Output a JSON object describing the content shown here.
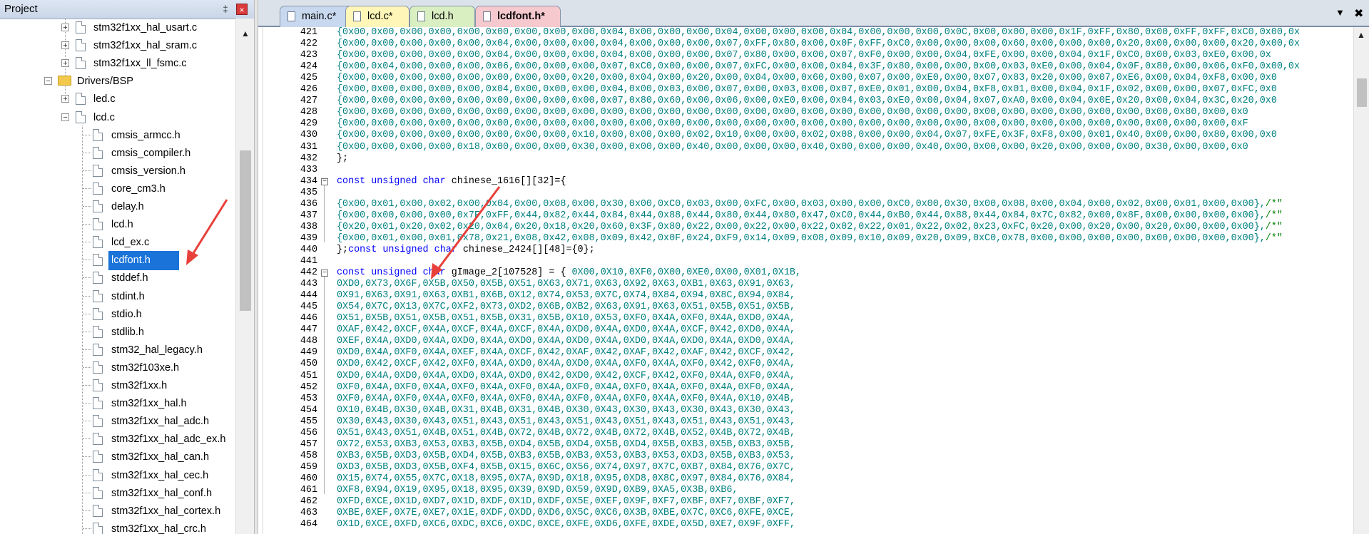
{
  "project_panel": {
    "title": "Project",
    "pin_glyph": "‡",
    "close_glyph": "×",
    "tree": [
      {
        "label": "stm32f1xx_hal_usart.c",
        "kind": "file-expand"
      },
      {
        "label": "stm32f1xx_hal_sram.c",
        "kind": "file-expand"
      },
      {
        "label": "stm32f1xx_ll_fsmc.c",
        "kind": "file-expand"
      },
      {
        "label": "Drivers/BSP",
        "kind": "folder"
      },
      {
        "label": "led.c",
        "kind": "file-expand"
      },
      {
        "label": "lcd.c",
        "kind": "file-collapse"
      },
      {
        "label": "cmsis_armcc.h",
        "kind": "header"
      },
      {
        "label": "cmsis_compiler.h",
        "kind": "header"
      },
      {
        "label": "cmsis_version.h",
        "kind": "header"
      },
      {
        "label": "core_cm3.h",
        "kind": "header"
      },
      {
        "label": "delay.h",
        "kind": "header"
      },
      {
        "label": "lcd.h",
        "kind": "header"
      },
      {
        "label": "lcd_ex.c",
        "kind": "header"
      },
      {
        "label": "lcdfont.h",
        "kind": "header",
        "selected": true
      },
      {
        "label": "stddef.h",
        "kind": "header"
      },
      {
        "label": "stdint.h",
        "kind": "header"
      },
      {
        "label": "stdio.h",
        "kind": "header"
      },
      {
        "label": "stdlib.h",
        "kind": "header"
      },
      {
        "label": "stm32_hal_legacy.h",
        "kind": "header"
      },
      {
        "label": "stm32f103xe.h",
        "kind": "header"
      },
      {
        "label": "stm32f1xx.h",
        "kind": "header"
      },
      {
        "label": "stm32f1xx_hal.h",
        "kind": "header"
      },
      {
        "label": "stm32f1xx_hal_adc.h",
        "kind": "header"
      },
      {
        "label": "stm32f1xx_hal_adc_ex.h",
        "kind": "header"
      },
      {
        "label": "stm32f1xx_hal_can.h",
        "kind": "header"
      },
      {
        "label": "stm32f1xx_hal_cec.h",
        "kind": "header"
      },
      {
        "label": "stm32f1xx_hal_conf.h",
        "kind": "header"
      },
      {
        "label": "stm32f1xx_hal_cortex.h",
        "kind": "header"
      },
      {
        "label": "stm32f1xx_hal_crc.h",
        "kind": "header"
      }
    ]
  },
  "editor": {
    "tabs": [
      {
        "label": "main.c*"
      },
      {
        "label": "lcd.c*"
      },
      {
        "label": "lcd.h"
      },
      {
        "label": "lcdfont.h*",
        "active": true
      }
    ],
    "tab_menu_glyph": "▼",
    "tab_close_glyph": "✖",
    "lines": [
      {
        "n": "421",
        "t": "{0x00,0x00,0x00,0x00,0x00,0x00,0x00,0x00,0x00,0x04,0x00,0x00,0x00,0x04,0x00,0x00,0x00,0x04,0x00,0x00,0x00,0x0C,0x00,0x00,0x00,0x1F,0xFF,0x80,0x00,0xFF,0xFF,0xC0,0x00,0x"
      },
      {
        "n": "422",
        "t": "{0x00,0x00,0x00,0x00,0x00,0x04,0x00,0x00,0x00,0x04,0x00,0x00,0x00,0x07,0xFF,0x80,0x00,0x0F,0xFF,0xC0,0x00,0x00,0x00,0x60,0x00,0x00,0x00,0x20,0x00,0x00,0x00,0x20,0x00,0x"
      },
      {
        "n": "423",
        "t": "{0x00,0x00,0x00,0x00,0x00,0x04,0x00,0x00,0x00,0x04,0x00,0x00,0x00,0x07,0x80,0x00,0x00,0x07,0xF0,0x00,0x00,0x04,0xFE,0x00,0x00,0x04,0x1F,0xC0,0x00,0x03,0xE0,0x00,0x"
      },
      {
        "n": "424",
        "t": "{0x00,0x04,0x00,0x00,0x00,0x06,0x00,0x00,0x00,0x07,0xC0,0x00,0x00,0x07,0xFC,0x00,0x00,0x04,0x3F,0x80,0x00,0x00,0x00,0x03,0xE0,0x00,0x04,0x0F,0x80,0x00,0x06,0xF0,0x00,0x"
      },
      {
        "n": "425",
        "t": "{0x00,0x00,0x00,0x00,0x00,0x00,0x00,0x00,0x20,0x00,0x04,0x00,0x20,0x00,0x04,0x00,0x60,0x00,0x07,0x00,0xE0,0x00,0x07,0x83,0x20,0x00,0x07,0xE6,0x00,0x04,0xF8,0x00,0x0"
      },
      {
        "n": "426",
        "t": "{0x00,0x00,0x00,0x00,0x00,0x04,0x00,0x00,0x00,0x04,0x00,0x03,0x00,0x07,0x00,0x03,0x00,0x07,0xE0,0x01,0x00,0x04,0xF8,0x01,0x00,0x04,0x1F,0x02,0x00,0x00,0x07,0xFC,0x0"
      },
      {
        "n": "427",
        "t": "{0x00,0x00,0x00,0x00,0x00,0x00,0x00,0x00,0x00,0x07,0x80,0x60,0x00,0x06,0x00,0xE0,0x00,0x04,0x03,0xE0,0x00,0x04,0x07,0xA0,0x00,0x04,0x0E,0x20,0x00,0x04,0x3C,0x20,0x0"
      },
      {
        "n": "428",
        "t": "{0x00,0x00,0x00,0x00,0x00,0x00,0x00,0x00,0x00,0x00,0x00,0x00,0x00,0x00,0x00,0x00,0x00,0x00,0x00,0x00,0x00,0x00,0x00,0x00,0x00,0x00,0x00,0x00,0x00,0x80,0x00,0x0"
      },
      {
        "n": "429",
        "t": "{0x00,0x00,0x00,0x00,0x00,0x00,0x00,0x00,0x00,0x00,0x00,0x00,0x00,0x00,0x00,0x00,0x00,0x00,0x00,0x00,0x00,0x00,0x00,0x00,0x00,0x00,0x00,0x00,0x00,0x00,0x00,0xF"
      },
      {
        "n": "430",
        "t": "{0x00,0x00,0x00,0x00,0x00,0x00,0x00,0x00,0x10,0x00,0x00,0x00,0x02,0x10,0x00,0x00,0x02,0x08,0x00,0x00,0x04,0x07,0xFE,0x3F,0xF8,0x00,0x01,0x40,0x00,0x00,0x80,0x00,0x0"
      },
      {
        "n": "431",
        "t": "{0x00,0x00,0x00,0x00,0x18,0x00,0x00,0x00,0x30,0x00,0x00,0x00,0x40,0x00,0x00,0x00,0x40,0x00,0x00,0x00,0x40,0x00,0x00,0x00,0x20,0x00,0x00,0x00,0x30,0x00,0x00,0x0"
      },
      {
        "n": "432",
        "t": "};",
        "style": "plain"
      },
      {
        "n": "433",
        "t": ""
      },
      {
        "n": "434",
        "t": "const unsigned char chinese_1616[][32]={",
        "style": "decl",
        "fold": "start"
      },
      {
        "n": "435",
        "t": ""
      },
      {
        "n": "436",
        "t": "{0x00,0x01,0x00,0x02,0x00,0x04,0x00,0x08,0x00,0x30,0x00,0xC0,0x03,0x00,0xFC,0x00,0x03,0x00,0x00,0xC0,0x00,0x30,0x00,0x08,0x00,0x04,0x00,0x02,0x00,0x01,0x00,0x00},/*\""
      },
      {
        "n": "437",
        "t": "{0x00,0x00,0x00,0x00,0x7F,0xFF,0x44,0x82,0x44,0x84,0x44,0x88,0x44,0x80,0x44,0x80,0x47,0xC0,0x44,0xB0,0x44,0x88,0x44,0x84,0x7C,0x82,0x00,0x8F,0x00,0x00,0x00,0x00},/*\""
      },
      {
        "n": "438",
        "t": "{0x20,0x01,0x20,0x02,0x20,0x04,0x20,0x18,0x20,0x60,0x3F,0x80,0x22,0x00,0x22,0x00,0x22,0x02,0x22,0x01,0x22,0x02,0x23,0xFC,0x20,0x00,0x20,0x00,0x20,0x00,0x00,0x00},/*\""
      },
      {
        "n": "439",
        "t": "{0x00,0x01,0x00,0x01,0x78,0x21,0x08,0x42,0x08,0x09,0x42,0x0F,0x24,0xF9,0x14,0x09,0x08,0x09,0x10,0x09,0x20,0x09,0xC0,0x78,0x00,0x00,0x00,0x00,0x00,0x00,0x00,0x00},/*\""
      },
      {
        "n": "440",
        "t": "};const unsigned char chinese_2424[][48]={0};",
        "style": "decl2"
      },
      {
        "n": "441",
        "t": ""
      },
      {
        "n": "442",
        "t": "const unsigned char gImage_2[107528] = { 0X00,0X10,0XF0,0X00,0XE0,0X00,0X01,0X1B,",
        "style": "decl3",
        "fold": "start"
      },
      {
        "n": "443",
        "t": "0XD0,0X73,0X6F,0X5B,0X50,0X5B,0X51,0X63,0X71,0X63,0X92,0X63,0XB1,0X63,0X91,0X63,"
      },
      {
        "n": "444",
        "t": "0X91,0X63,0X91,0X63,0XB1,0X6B,0X12,0X74,0X53,0X7C,0X74,0X84,0X94,0X8C,0X94,0X84,"
      },
      {
        "n": "445",
        "t": "0X54,0X7C,0X13,0X7C,0XF2,0X73,0XD2,0X6B,0XB2,0X63,0X91,0X63,0X51,0X5B,0X51,0X5B,"
      },
      {
        "n": "446",
        "t": "0X51,0X5B,0X51,0X5B,0X51,0X5B,0X31,0X5B,0X10,0X53,0XF0,0X4A,0XF0,0X4A,0XD0,0X4A,"
      },
      {
        "n": "447",
        "t": "0XAF,0X42,0XCF,0X4A,0XCF,0X4A,0XCF,0X4A,0XD0,0X4A,0XD0,0X4A,0XCF,0X42,0XD0,0X4A,"
      },
      {
        "n": "448",
        "t": "0XEF,0X4A,0XD0,0X4A,0XD0,0X4A,0XD0,0X4A,0XD0,0X4A,0XD0,0X4A,0XD0,0X4A,0XD0,0X4A,"
      },
      {
        "n": "449",
        "t": "0XD0,0X4A,0XF0,0X4A,0XEF,0X4A,0XCF,0X42,0XAF,0X42,0XAF,0X42,0XAF,0X42,0XCF,0X42,"
      },
      {
        "n": "450",
        "t": "0XD0,0X42,0XCF,0X42,0XF0,0X4A,0XD0,0X4A,0XD0,0X4A,0XF0,0X4A,0XF0,0X42,0XF0,0X4A,"
      },
      {
        "n": "451",
        "t": "0XD0,0X4A,0XD0,0X4A,0XD0,0X4A,0XD0,0X42,0XD0,0X42,0XCF,0X42,0XF0,0X4A,0XF0,0X4A,"
      },
      {
        "n": "452",
        "t": "0XF0,0X4A,0XF0,0X4A,0XF0,0X4A,0XF0,0X4A,0XF0,0X4A,0XF0,0X4A,0XF0,0X4A,0XF0,0X4A,"
      },
      {
        "n": "453",
        "t": "0XF0,0X4A,0XF0,0X4A,0XF0,0X4A,0XF0,0X4A,0XF0,0X4A,0XF0,0X4A,0XF0,0X4A,0X10,0X4B,"
      },
      {
        "n": "454",
        "t": "0X10,0X4B,0X30,0X4B,0X31,0X4B,0X31,0X4B,0X30,0X43,0X30,0X43,0X30,0X43,0X30,0X43,"
      },
      {
        "n": "455",
        "t": "0X30,0X43,0X30,0X43,0X51,0X43,0X51,0X43,0X51,0X43,0X51,0X43,0X51,0X43,0X51,0X43,"
      },
      {
        "n": "456",
        "t": "0X51,0X43,0X51,0X4B,0X51,0X4B,0X72,0X4B,0X72,0X4B,0X72,0X4B,0X52,0X4B,0X72,0X4B,"
      },
      {
        "n": "457",
        "t": "0X72,0X53,0XB3,0X53,0XB3,0X5B,0XD4,0X5B,0XD4,0X5B,0XD4,0X5B,0XB3,0X5B,0XB3,0X5B,"
      },
      {
        "n": "458",
        "t": "0XB3,0X5B,0XD3,0X5B,0XD4,0X5B,0XB3,0X5B,0XB3,0X53,0XB3,0X53,0XD3,0X5B,0XB3,0X53,"
      },
      {
        "n": "459",
        "t": "0XD3,0X5B,0XD3,0X5B,0XF4,0X5B,0X15,0X6C,0X56,0X74,0X97,0X7C,0XB7,0X84,0X76,0X7C,"
      },
      {
        "n": "460",
        "t": "0X15,0X74,0X55,0X7C,0X18,0X95,0X7A,0X9D,0X18,0X95,0XD8,0X8C,0X97,0X84,0X76,0X84,"
      },
      {
        "n": "461",
        "t": "0XF8,0X94,0X19,0X95,0X18,0X95,0X39,0X9D,0X59,0X9D,0XB9,0XA5,0X3B,0XB6,"
      },
      {
        "n": "462",
        "t": "0XFD,0XCE,0X1D,0XD7,0X1D,0XDF,0X1D,0XDF,0X5E,0XEF,0X9F,0XF7,0XBF,0XF7,0XBF,0XF7,"
      },
      {
        "n": "463",
        "t": "0XBE,0XEF,0X7E,0XE7,0X1E,0XDF,0XDD,0XD6,0X5C,0XC6,0X3B,0XBE,0X7C,0XC6,0XFE,0XCE,"
      },
      {
        "n": "464",
        "t": "0X1D,0XCE,0XFD,0XC6,0XDC,0XC6,0XDC,0XCE,0XFE,0XD6,0XFE,0XDE,0X5D,0XE7,0X9F,0XFF,"
      }
    ]
  },
  "colors": {
    "selection": "#1a73d9",
    "code_hex": "#008080",
    "keyword": "#0000ff",
    "annotation_arrow": "#e8403a"
  }
}
